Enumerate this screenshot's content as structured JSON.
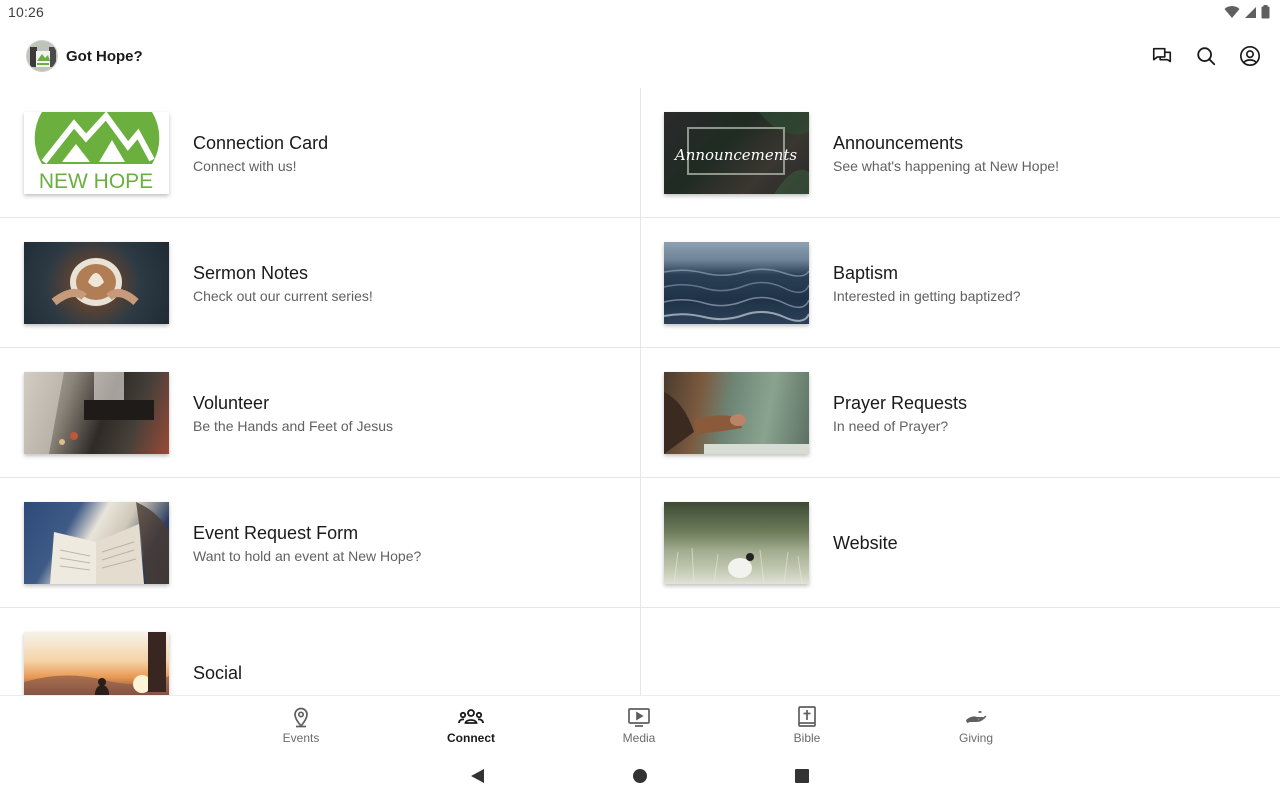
{
  "status_bar": {
    "time": "10:26"
  },
  "app_bar": {
    "title": "Got Hope?",
    "actions": [
      "chat-icon",
      "search-icon",
      "account-icon"
    ]
  },
  "tiles": [
    {
      "title": "Connection Card",
      "subtitle": "Connect with us!",
      "thumb": "new-hope-logo",
      "logo_text": "NEW HOPE",
      "accent": "#6bb03e"
    },
    {
      "title": "Announcements",
      "subtitle": "See what's happening at New Hope!",
      "thumb": "announcements-image",
      "image_text": "Announcements"
    },
    {
      "title": "Sermon Notes",
      "subtitle": "Check out our current series!",
      "thumb": "coffee-cup-image"
    },
    {
      "title": "Baptism",
      "subtitle": "Interested in getting baptized?",
      "thumb": "water-image"
    },
    {
      "title": "Volunteer",
      "subtitle": "Be the Hands and Feet of Jesus",
      "thumb": "volunteer-image"
    },
    {
      "title": "Prayer Requests",
      "subtitle": "In need of Prayer?",
      "thumb": "praying-hands-image"
    },
    {
      "title": "Event Request Form",
      "subtitle": "Want to hold an event at New Hope?",
      "thumb": "bible-image"
    },
    {
      "title": "Website",
      "subtitle": "",
      "thumb": "field-lamb-image"
    },
    {
      "title": "Social",
      "subtitle": "",
      "thumb": "sunset-people-image"
    }
  ],
  "bottom_nav": [
    {
      "label": "Events",
      "icon": "location-pin-icon",
      "active": false
    },
    {
      "label": "Connect",
      "icon": "people-group-icon",
      "active": true
    },
    {
      "label": "Media",
      "icon": "play-screen-icon",
      "active": false
    },
    {
      "label": "Bible",
      "icon": "bible-cross-icon",
      "active": false
    },
    {
      "label": "Giving",
      "icon": "giving-hand-icon",
      "active": false
    }
  ],
  "system_nav": [
    "back-icon",
    "home-icon",
    "recents-icon"
  ]
}
